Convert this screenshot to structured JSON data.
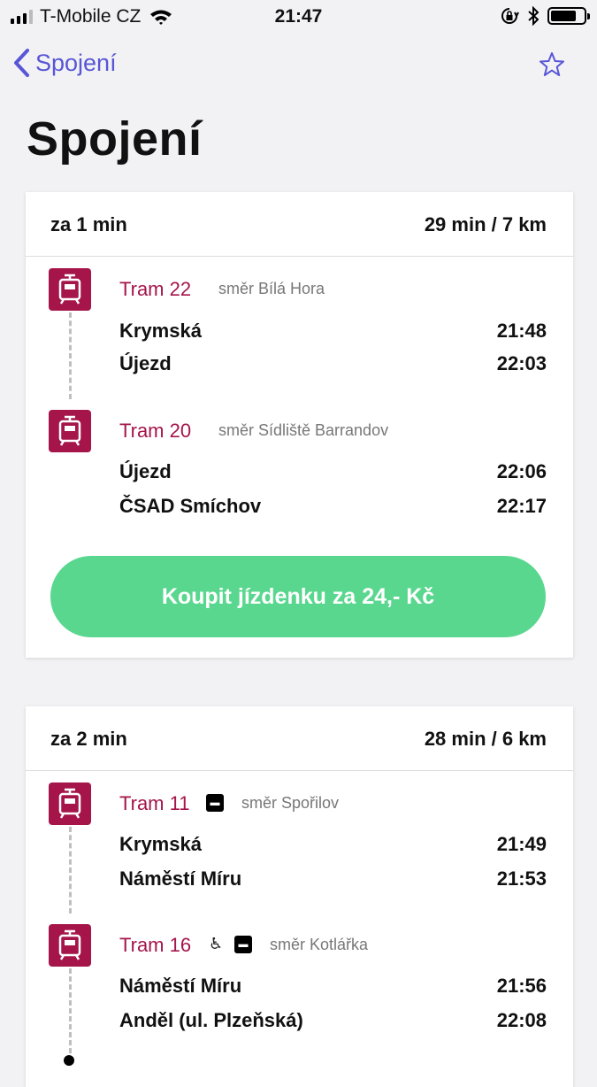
{
  "status_bar": {
    "carrier": "T-Mobile CZ",
    "time": "21:47"
  },
  "nav": {
    "back_label": "Spojení"
  },
  "page": {
    "title": "Spojení"
  },
  "colors": {
    "accent": "#5856d6",
    "tram": "#a5154a",
    "buy_button": "#5ad78f"
  },
  "connections": [
    {
      "eta": "za 1 min",
      "summary": "29 min / 7 km",
      "legs": [
        {
          "line": "Tram 22",
          "direction": "směr Bílá Hora",
          "from": "Krymská",
          "from_time": "21:48",
          "to": "Újezd",
          "to_time": "22:03"
        },
        {
          "line": "Tram 20",
          "direction": "směr Sídliště Barrandov",
          "from": "Újezd",
          "from_time": "22:06",
          "to": "ČSAD Smíchov",
          "to_time": "22:17"
        }
      ],
      "buy_label": "Koupit jízdenku za 24,- Kč"
    },
    {
      "eta": "za 2 min",
      "summary": "28 min / 6 km",
      "legs": [
        {
          "line": "Tram 11",
          "direction": "směr Spořilov",
          "low_floor": true,
          "from": "Krymská",
          "from_time": "21:49",
          "to": "Náměstí Míru",
          "to_time": "21:53"
        },
        {
          "line": "Tram 16",
          "direction": "směr Kotlářka",
          "wheelchair": true,
          "low_floor": true,
          "from": "Náměstí Míru",
          "from_time": "21:56",
          "to": "Anděl (ul. Plzeňská)",
          "to_time": "22:08"
        }
      ]
    }
  ]
}
